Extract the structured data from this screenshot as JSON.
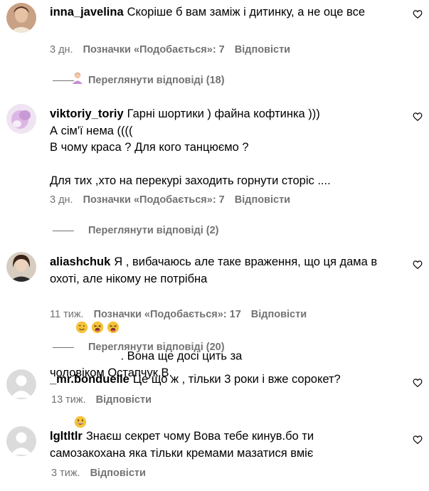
{
  "comments": [
    {
      "username": "inna_javelina",
      "lines": [
        "Скоріше б вам заміж і дитинку, а не оце все"
      ],
      "emoji_line": "person-emoji",
      "age": "3 дн.",
      "likes": "Позначки «Подобається»: 7",
      "reply": "Відповісти",
      "view_replies": "Переглянути відповіді (18)"
    },
    {
      "username": "viktoriy_toriy",
      "lines": [
        "Гарні шортики ) файна кофтинка )))",
        "А сім'ї нема ((((",
        "В чому краса ? Для кого танцюємо ?",
        "",
        "Для тих ,хто на перекурі заходить горнути сторіс ...."
      ],
      "age": "3 дн.",
      "likes": "Позначки «Подобається»: 7",
      "reply": "Відповісти",
      "view_replies": "Переглянути відповіді (2)"
    },
    {
      "username": "aliashchuk",
      "lines": [
        "Я , вибачаюсь але таке враження, що ця дама в",
        "охоті, але нікому не потрібна",
        ". Вона ще досі цить за",
        "чоловіком Остапчук.В."
      ],
      "age": "11 тиж.",
      "likes": "Позначки «Подобається»: 17",
      "reply": "Відповісти",
      "view_replies": "Переглянути відповіді (20)"
    },
    {
      "username": "_mr.bonduelle",
      "lines": [
        "Це що ж , тільки 3 роки і вже сорокет?"
      ],
      "age": "13 тиж.",
      "reply": "Відповісти"
    },
    {
      "username": "lgltltlr",
      "lines": [
        "Знаєш секрет чому Вова тебе кинув.бо ти",
        "самозакохана яка тільки кремами мазатися вміє"
      ],
      "age": "3 тиж.",
      "reply": "Відповісти"
    }
  ],
  "icons": {
    "like": "heart-outline-icon",
    "avatar_default": "default-avatar-icon"
  },
  "colors": {
    "meta_text": "#737373",
    "text": "#000000",
    "emoji_face": "#f5c33b",
    "emoji_blush": "#e0607e"
  }
}
